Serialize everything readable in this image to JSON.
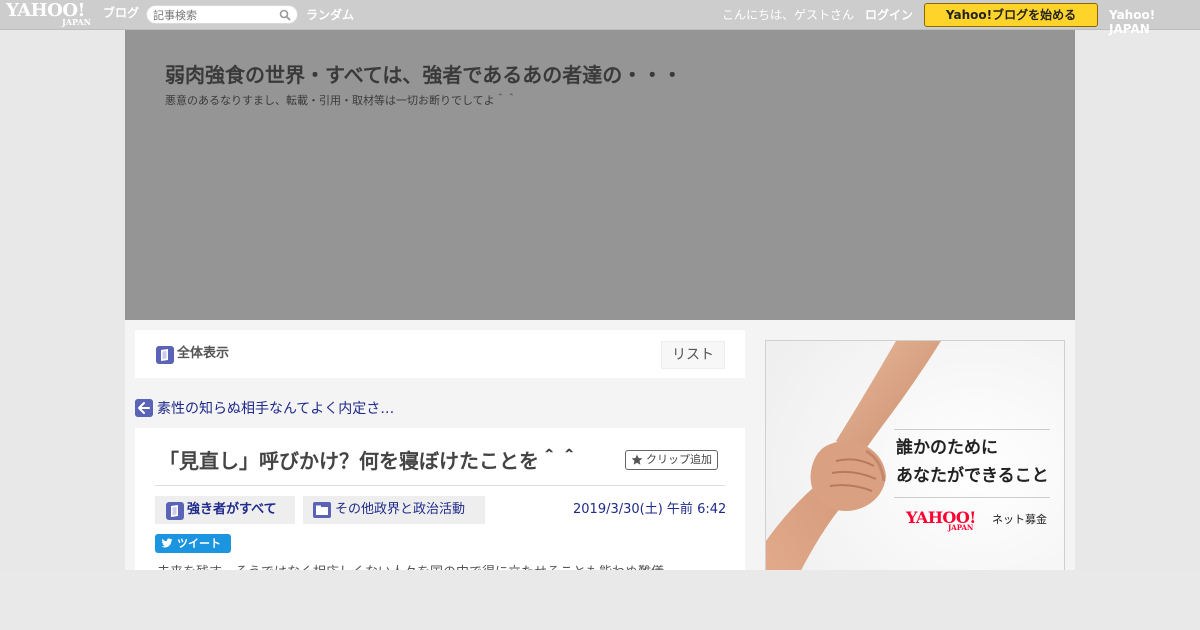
{
  "topbar": {
    "logo_text": "YAHOO!",
    "logo_sub": "JAPAN",
    "logo_blog": "ブログ",
    "search_placeholder": "記事検索",
    "random_label": "ランダム",
    "greeting": "こんにちは、ゲストさん",
    "login_label": "ログイン",
    "start_button_label": "Yahoo!ブログを始める",
    "yahoo_japan_label": "Yahoo! JAPAN"
  },
  "header": {
    "title": "弱肉強食の世界・すべては、強者であるあの者達の・・・",
    "description": "悪意のあるなりすまし、転載・引用・取材等は一切お断りでしてよ＾＾"
  },
  "toolbar": {
    "full_view_label": "全体表示",
    "list_label": "リスト"
  },
  "prev_article": {
    "label": "素性の知らぬ相手なんてよく内定さ…"
  },
  "article": {
    "title": "「見直し」呼びかけ？何を寝ぼけたことを＾＾",
    "clip_label": "クリップ追加",
    "tag_main": "強き者がすべて",
    "tag_category": "その他政界と政治活動",
    "date": "2019/3/30(土) 午前 6:42",
    "tweet_label": "ツイート",
    "body_preview": "未来を残す…そうではなく相応しくない人々を国の中で得に立たせることも能わぬ難儀"
  },
  "ad": {
    "copy_line1": "誰かのために",
    "copy_line2": "あなたができること",
    "brand_main": "YAHOO!",
    "brand_sub": "JAPAN",
    "brand_name": "ネット募金"
  },
  "colors": {
    "topbar_bg": "#cdcdcd",
    "header_bg": "#959595",
    "accent_blue": "#1f2a8a",
    "icon_purple": "#5b63b6",
    "start_yellow": "#ffd42a",
    "twitter_blue": "#1b95e0",
    "yahoo_red": "#ff0033"
  }
}
